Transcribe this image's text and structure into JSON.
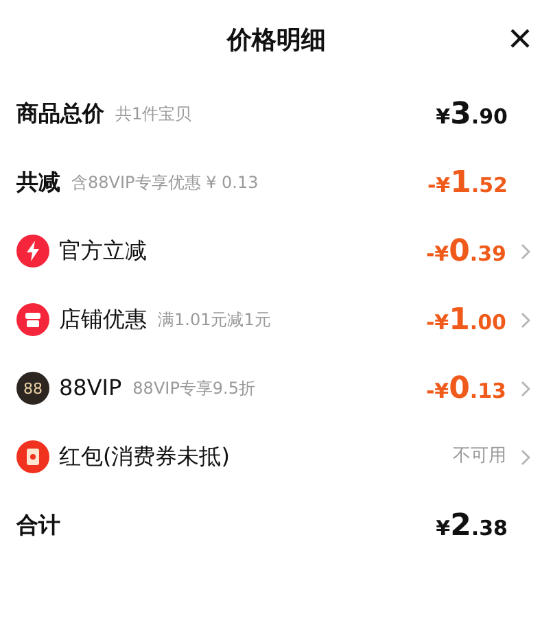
{
  "title": "价格明细",
  "rows": [
    {
      "kind": "summary",
      "label": "商品总价",
      "note": "共1件宝贝",
      "amount": "¥3.90",
      "discount": false
    },
    {
      "kind": "summary",
      "label": "共减",
      "note": "含88VIP专享优惠 ¥ 0.13",
      "amount": "-¥1.52",
      "discount": true
    },
    {
      "kind": "detail",
      "label": "官方立减",
      "amount": "-¥0.39",
      "discount": true
    },
    {
      "kind": "detail",
      "label": "店铺优惠",
      "note": "满1.01元减1元",
      "amount": "-¥1.00",
      "discount": true
    },
    {
      "kind": "detail",
      "badge": "88",
      "label": "88VIP",
      "note": "88VIP专享9.5折",
      "amount": "-¥0.13",
      "discount": true
    },
    {
      "kind": "detail",
      "label": "红包(消费券未抵)",
      "status": "不可用"
    },
    {
      "kind": "summary",
      "label": "合计",
      "amount": "¥2.38",
      "discount": false
    }
  ]
}
